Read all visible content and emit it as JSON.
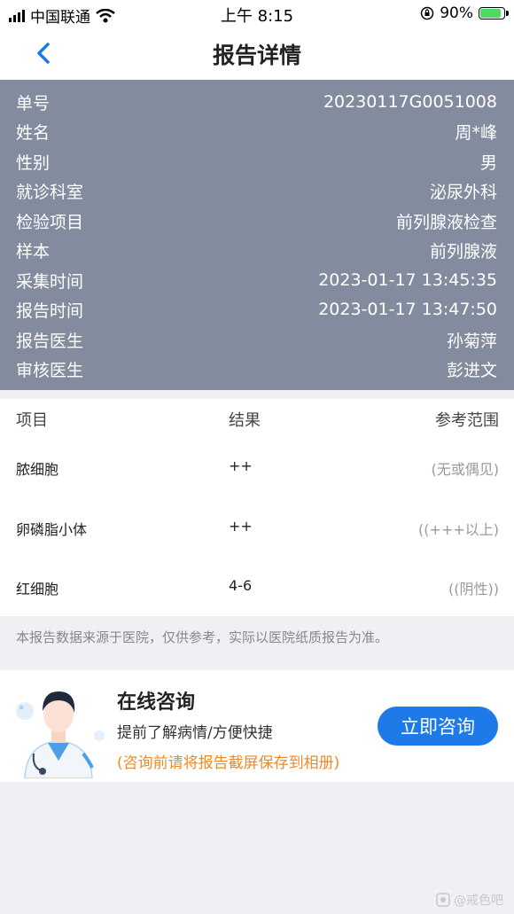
{
  "status_bar": {
    "carrier": "中国联通",
    "time": "上午 8:15",
    "battery_percent": "90%",
    "battery_level": 0.9,
    "icons": [
      "signal-icon",
      "wifi-icon",
      "orientation-lock-icon",
      "battery-icon"
    ]
  },
  "nav": {
    "title": "报告详情",
    "back_icon": "chevron-left-icon"
  },
  "info": [
    {
      "label": "单号",
      "value": "20230117G0051008"
    },
    {
      "label": "姓名",
      "value": "周*峰"
    },
    {
      "label": "性别",
      "value": "男"
    },
    {
      "label": "就诊科室",
      "value": "泌尿外科"
    },
    {
      "label": "检验项目",
      "value": "前列腺液检查"
    },
    {
      "label": "样本",
      "value": "前列腺液"
    },
    {
      "label": "采集时间",
      "value": "2023-01-17 13:45:35"
    },
    {
      "label": "报告时间",
      "value": "2023-01-17 13:47:50"
    },
    {
      "label": "报告医生",
      "value": "孙菊萍"
    },
    {
      "label": "审核医生",
      "value": "彭进文"
    }
  ],
  "results": {
    "headers": [
      "项目",
      "结果",
      "参考范围"
    ],
    "rows": [
      {
        "item": "脓细胞",
        "result": "++",
        "range": "(无或偶见)"
      },
      {
        "item": "卵磷脂小体",
        "result": "++",
        "range": "((+++以上)"
      },
      {
        "item": "红细胞",
        "result": "4-6",
        "range": "((阴性))"
      }
    ]
  },
  "disclaimer": "本报告数据来源于医院，仅供参考，实际以医院纸质报告为准。",
  "consult": {
    "title": "在线咨询",
    "subtitle": "提前了解病情/方便快捷",
    "note": "(咨询前请将报告截屏保存到相册)",
    "button": "立即咨询"
  },
  "watermark": "@戒色吧",
  "colors": {
    "panel": "#828c9e",
    "accent": "#1e7ae8",
    "note": "#f08a24"
  }
}
